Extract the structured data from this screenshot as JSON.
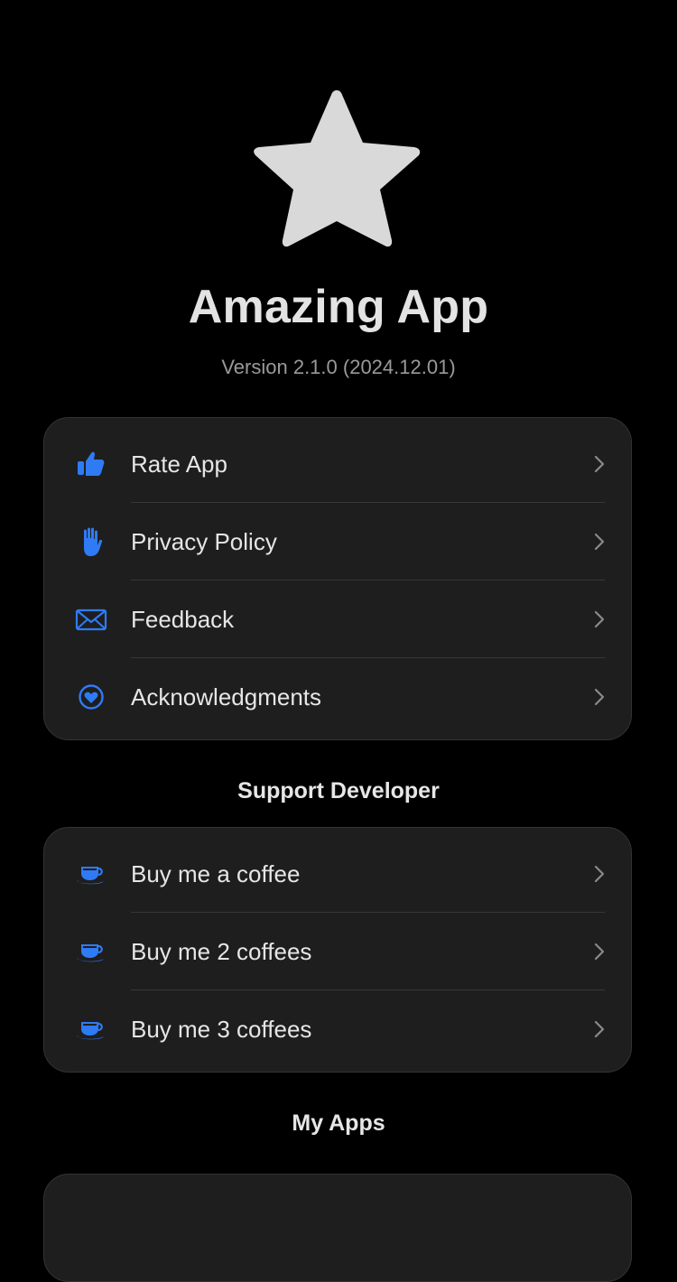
{
  "app": {
    "name": "Amazing App",
    "version": "Version 2.1.0 (2024.12.01)",
    "logo_icon": "star-icon"
  },
  "colors": {
    "background": "#000000",
    "card": "#1e1e1e",
    "accent": "#2f7bf6",
    "text": "#e6e6e6",
    "secondary_text": "#9a9a9a",
    "star": "#d9d9d9"
  },
  "info_section": {
    "items": [
      {
        "label": "Rate App",
        "icon": "thumbs-up-icon"
      },
      {
        "label": "Privacy Policy",
        "icon": "hand-raised-icon"
      },
      {
        "label": "Feedback",
        "icon": "envelope-icon"
      },
      {
        "label": "Acknowledgments",
        "icon": "heart-circle-icon"
      }
    ]
  },
  "support_section": {
    "title": "Support Developer",
    "items": [
      {
        "label": "Buy me a coffee",
        "icon": "coffee-cup-icon"
      },
      {
        "label": "Buy me 2 coffees",
        "icon": "coffee-cup-icon"
      },
      {
        "label": "Buy me 3 coffees",
        "icon": "coffee-cup-icon"
      }
    ]
  },
  "apps_section": {
    "title": "My Apps"
  }
}
